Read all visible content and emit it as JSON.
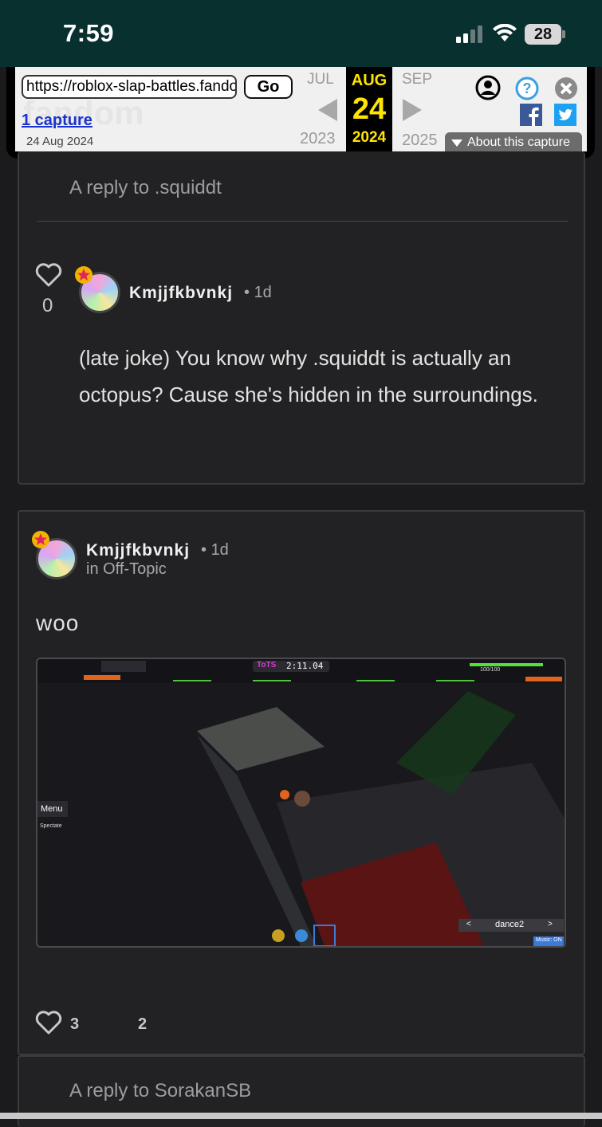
{
  "status": {
    "time": "7:59",
    "battery": "28"
  },
  "wayback": {
    "url": "https://roblox-slap-battles.fandom.com",
    "go_label": "Go",
    "captures": "1 capture",
    "capture_date": "24 Aug 2024",
    "prev_month": "JUL",
    "cur_month": "AUG",
    "next_month": "SEP",
    "cur_day": "24",
    "prev_year": "2023",
    "cur_year": "2024",
    "next_year": "2025",
    "about": "About this capture",
    "accent": "#ffe400"
  },
  "thread": {
    "reply_top": "A reply to .squiddt",
    "comment": {
      "likes": "0",
      "username": "Kmjjfkbvnkj",
      "time": "1d",
      "text": "(late joke) You know why .squiddt is actually an octopus? Cause she's hidden in the surroundings."
    },
    "post": {
      "username": "Kmjjfkbvnkj",
      "time": "1d",
      "category": "in Off-Topic",
      "title": "woo",
      "likes": "3",
      "replies": "2",
      "game": {
        "timer": "2:11.04",
        "tag": "ToTS",
        "menu": "Menu",
        "spectate": "Spectate",
        "emote": "dance2",
        "music": "Music: ON",
        "health": "100/100"
      }
    },
    "reply_bottom": "A reply to SorakanSB"
  }
}
